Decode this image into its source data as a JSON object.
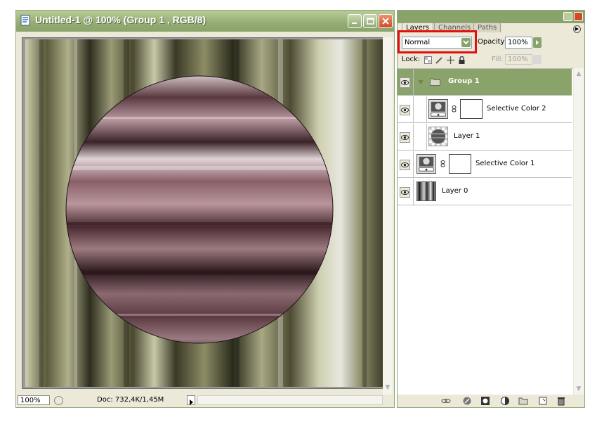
{
  "document": {
    "title": "Untitled-1 @ 100% (Group 1 , RGB/8)",
    "zoom": "100%",
    "doc_info": "Doc: 732,4K/1,45M"
  },
  "panel": {
    "tabs": [
      {
        "label": "Layers",
        "active": true
      },
      {
        "label": "Channels",
        "active": false
      },
      {
        "label": "Paths",
        "active": false
      }
    ],
    "blend_mode": "Normal",
    "opacity_label": "Opacity:",
    "opacity_value": "100%",
    "lock_label": "Lock:",
    "fill_label": "Fill:",
    "fill_value": "100%",
    "layers": [
      {
        "name": "Group 1",
        "kind": "group",
        "selected": true
      },
      {
        "name": "Selective Color 2",
        "kind": "adjustment",
        "indented": true
      },
      {
        "name": "Layer 1",
        "kind": "pixel",
        "indented": true
      },
      {
        "name": "Selective Color 1",
        "kind": "adjustment"
      },
      {
        "name": "Layer 0",
        "kind": "pixel"
      }
    ]
  },
  "colors": {
    "title_bar": "#8aa36a",
    "selected_layer": "#8aa36a",
    "highlight_box": "#e01010",
    "wood_light": "#c9c9a6",
    "wood_dark": "#3b3a28",
    "sphere_base": "#7a5058"
  }
}
